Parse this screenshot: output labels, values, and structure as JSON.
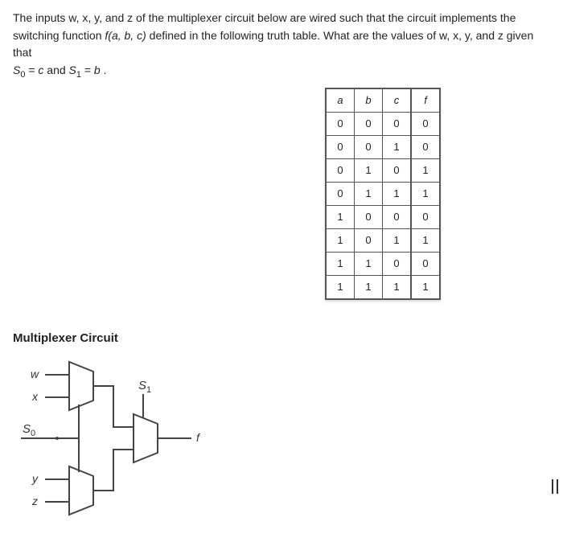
{
  "question": {
    "line1_pre": "The inputs w, x, y, and z of the multiplexer circuit below are wired such that the circuit implements the",
    "line2_pre": "switching function ",
    "line2_func": "f(a, b, c)",
    "line2_post": " defined in the following truth table. What are the values of w, x, y, and z given that",
    "line3_s0": "S",
    "line3_s0_sub": "0",
    "line3_mid1": " = ",
    "line3_c": "c",
    "line3_and": " and ",
    "line3_s1": "S",
    "line3_s1_sub": "1",
    "line3_mid2": " = ",
    "line3_b": "b",
    "line3_end": "."
  },
  "truth_table": {
    "headers": [
      "a",
      "b",
      "c",
      "f"
    ],
    "rows": [
      [
        "0",
        "0",
        "0",
        "0"
      ],
      [
        "0",
        "0",
        "1",
        "0"
      ],
      [
        "0",
        "1",
        "0",
        "1"
      ],
      [
        "0",
        "1",
        "1",
        "1"
      ],
      [
        "1",
        "0",
        "0",
        "0"
      ],
      [
        "1",
        "0",
        "1",
        "1"
      ],
      [
        "1",
        "1",
        "0",
        "0"
      ],
      [
        "1",
        "1",
        "1",
        "1"
      ]
    ]
  },
  "circuit": {
    "title": "Multiplexer Circuit",
    "labels": {
      "w": "w",
      "x": "x",
      "y": "y",
      "z": "z",
      "f": "f",
      "s0": "S",
      "s0_sub": "0",
      "s1": "S",
      "s1_sub": "1"
    }
  }
}
